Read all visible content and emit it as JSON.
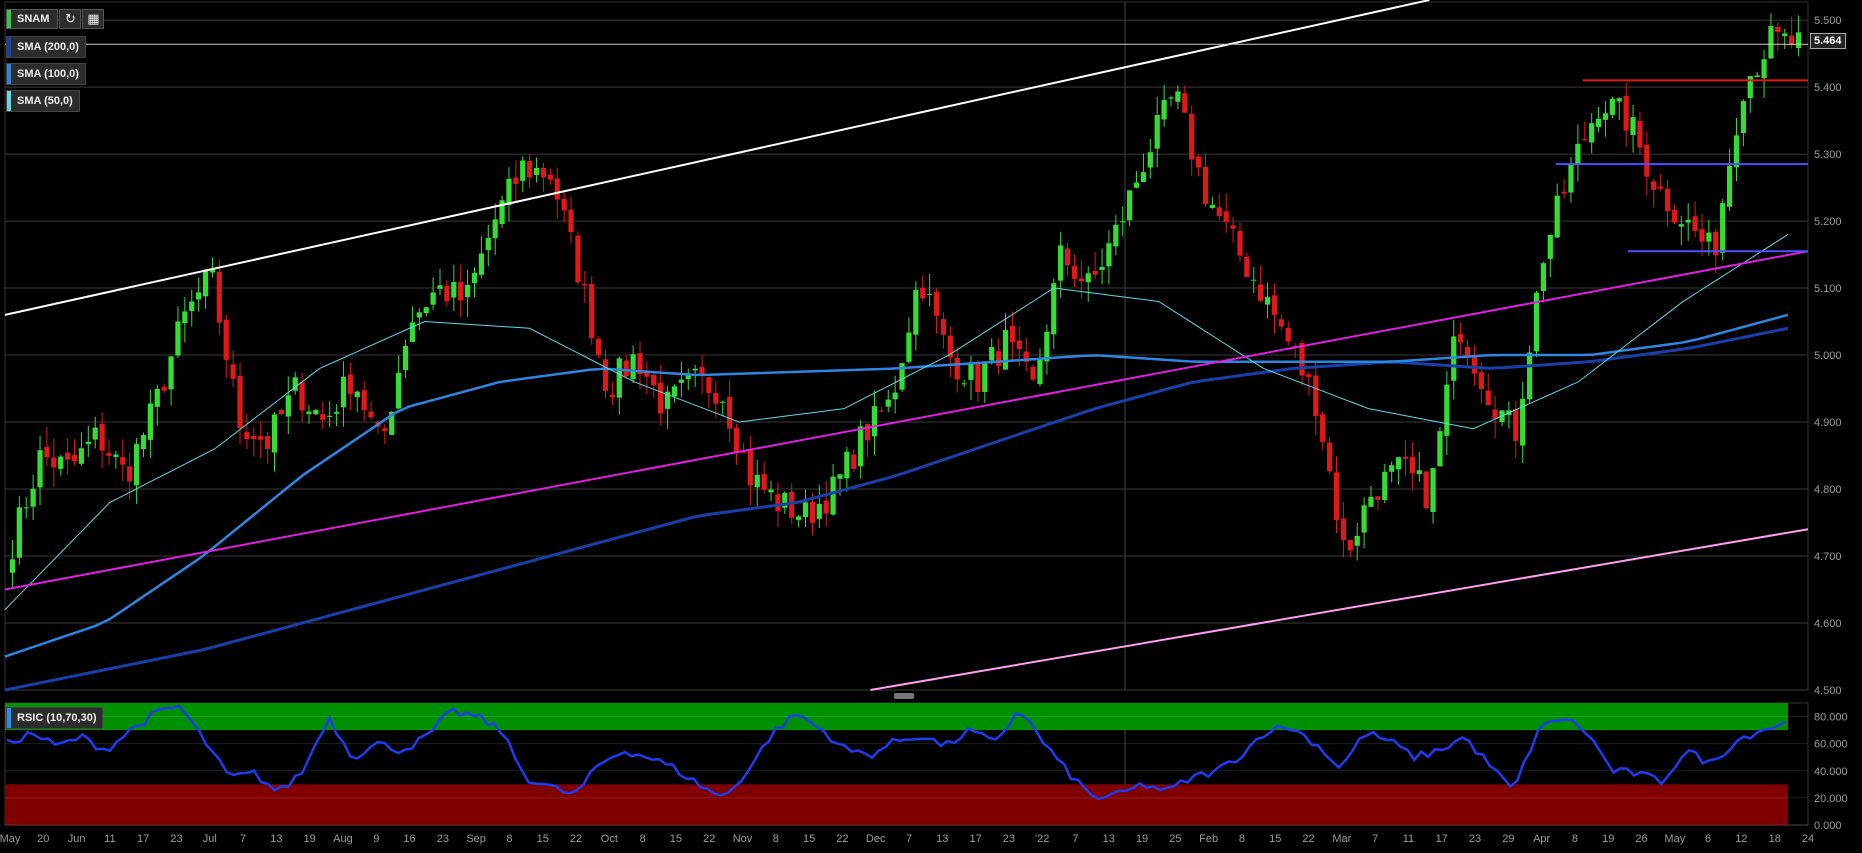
{
  "toolbar": {
    "symbol": "SNAM",
    "refresh_icon": "refresh-icon",
    "calendar_icon": "calendar-icon"
  },
  "legends": [
    {
      "label": "SMA (200,0)",
      "color": "#1a3fa8"
    },
    {
      "label": "SMA (100,0)",
      "color": "#2f86e0"
    },
    {
      "label": "SMA (50,0)",
      "color": "#5fd8e8"
    }
  ],
  "indicator": {
    "label": "RSIC (10,70,30)",
    "color": "#1e90ff"
  },
  "last_price": "5.464",
  "colors": {
    "up": "#33dd33",
    "down": "#e01818",
    "rsi_line": "#1e3cf0",
    "overbought": "#009000",
    "oversold": "#800000"
  },
  "chart_data": [
    {
      "type": "candlestick",
      "title": "SNAM",
      "ylim": [
        4.5,
        5.53
      ],
      "y_ticks": [
        "5.500",
        "5.400",
        "5.300",
        "5.200",
        "5.100",
        "5.000",
        "4.900",
        "4.800",
        "4.700",
        "4.600",
        "4.500"
      ],
      "x_ticks": [
        "May",
        "20",
        "Jun",
        "11",
        "17",
        "23",
        "Jul",
        "7",
        "13",
        "19",
        "Aug",
        "9",
        "16",
        "23",
        "Sep",
        "8",
        "15",
        "22",
        "Oct",
        "8",
        "15",
        "22",
        "Nov",
        "8",
        "15",
        "22",
        "Dec",
        "7",
        "13",
        "17",
        "23",
        "'22",
        "7",
        "13",
        "19",
        "25",
        "Feb",
        "8",
        "15",
        "22",
        "Mar",
        "7",
        "11",
        "17",
        "23",
        "29",
        "Apr",
        "8",
        "19",
        "26",
        "May",
        "6",
        "12",
        "18",
        "24"
      ],
      "close_anchors": [
        4.72,
        4.85,
        4.83,
        4.88,
        4.82,
        4.92,
        5.05,
        5.12,
        4.9,
        4.87,
        4.95,
        4.9,
        4.97,
        4.86,
        5.05,
        5.1,
        5.08,
        5.2,
        5.28,
        5.27,
        5.12,
        4.95,
        5.0,
        4.92,
        4.96,
        4.95,
        4.82,
        4.78,
        4.76,
        4.8,
        4.88,
        4.93,
        5.12,
        5.0,
        4.96,
        5.02,
        4.95,
        5.15,
        5.1,
        5.19,
        5.3,
        5.39,
        5.25,
        5.17,
        5.1,
        5.02,
        4.93,
        4.7,
        4.8,
        4.83,
        4.79,
        5.05,
        4.95,
        4.88,
        5.15,
        5.28,
        5.38,
        5.35,
        5.25,
        5.2,
        5.15,
        5.4,
        5.47,
        5.464
      ],
      "sma200_anchors": [
        4.5,
        4.53,
        4.56,
        4.6,
        4.64,
        4.68,
        4.72,
        4.76,
        4.78,
        4.82,
        4.87,
        4.92,
        4.96,
        4.98,
        4.99,
        4.98,
        4.99,
        5.01,
        5.04
      ],
      "sma100_anchors": [
        4.55,
        4.6,
        4.7,
        4.82,
        4.92,
        4.96,
        4.98,
        4.97,
        4.975,
        4.98,
        4.99,
        5.0,
        4.99,
        4.99,
        4.99,
        5.0,
        5.0,
        5.02,
        5.06
      ],
      "sma50_anchors": [
        4.62,
        4.78,
        4.86,
        4.98,
        5.05,
        5.04,
        4.96,
        4.9,
        4.92,
        5.0,
        5.1,
        5.08,
        4.98,
        4.92,
        4.89,
        4.96,
        5.08,
        5.18
      ],
      "trendlines": [
        {
          "name": "upper-channel",
          "color": "#ffffff",
          "from": [
            0,
            5.06
          ],
          "to": [
            0.79,
            5.53
          ]
        },
        {
          "name": "middle-channel",
          "color": "#e020e0",
          "from": [
            0,
            4.65
          ],
          "to": [
            1,
            5.155
          ]
        },
        {
          "name": "lower-channel",
          "color": "#ff9ff0",
          "from": [
            0.48,
            4.5
          ],
          "to": [
            1,
            4.74
          ]
        },
        {
          "name": "resistance-red",
          "color": "#e01818",
          "from": [
            0.875,
            5.41
          ],
          "to": [
            1,
            5.41
          ]
        },
        {
          "name": "resistance-blue",
          "color": "#5050ff",
          "from": [
            0.86,
            5.285
          ],
          "to": [
            1,
            5.285
          ]
        },
        {
          "name": "support-blue",
          "color": "#5050ff",
          "from": [
            0.9,
            5.155
          ],
          "to": [
            1,
            5.155
          ]
        },
        {
          "name": "last-price-line",
          "color": "#cccccc",
          "from": [
            0,
            5.464
          ],
          "to": [
            1,
            5.464
          ]
        }
      ]
    },
    {
      "type": "line",
      "title": "RSIC (10,70,30)",
      "ylim": [
        0,
        90
      ],
      "y_ticks": [
        "80.000",
        "60.000",
        "40.000",
        "20.000",
        "0.000"
      ],
      "bands": {
        "overbought": [
          70,
          90
        ],
        "oversold": [
          0,
          30
        ]
      },
      "rsi_anchors": [
        60,
        68,
        58,
        65,
        55,
        70,
        82,
        88,
        62,
        35,
        38,
        24,
        40,
        80,
        50,
        60,
        55,
        65,
        84,
        80,
        70,
        35,
        28,
        22,
        45,
        55,
        50,
        42,
        30,
        20,
        40,
        68,
        82,
        70,
        55,
        52,
        62,
        66,
        58,
        70,
        60,
        86,
        60,
        38,
        20,
        22,
        30,
        25,
        35,
        40,
        52,
        70,
        72,
        60,
        42,
        68,
        62,
        50,
        55,
        65,
        45,
        25,
        70,
        80,
        68,
        40,
        38,
        32,
        55,
        45,
        62,
        70,
        75
      ]
    }
  ]
}
